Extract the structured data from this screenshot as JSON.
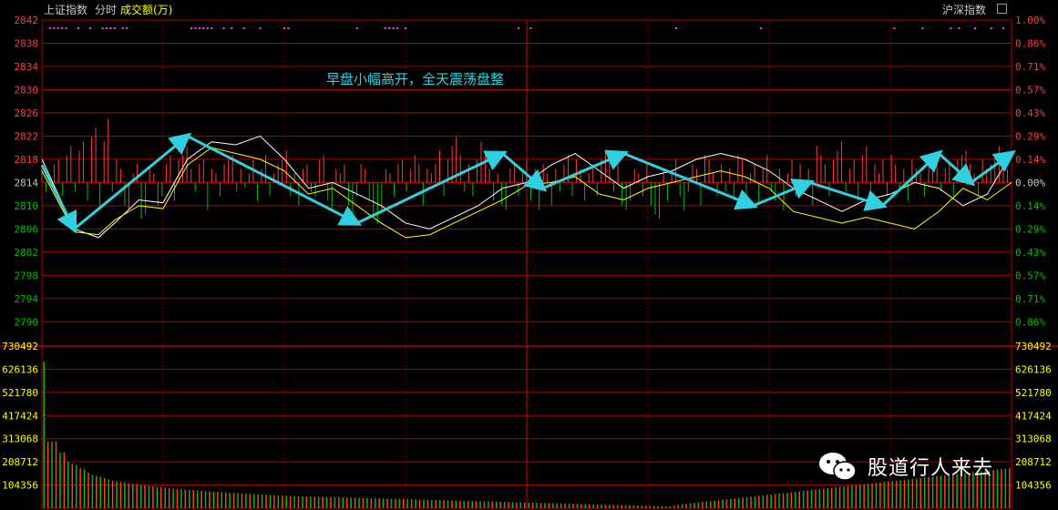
{
  "header": {
    "index_name": "上证指数",
    "mode_label": "分时",
    "volume_label": "成交额(万)",
    "market_label": "沪深指数"
  },
  "annotation": "早盘小幅高开，全天震荡盘整",
  "watermark": {
    "text": "股道行人来去",
    "icon": "wechat-icon"
  },
  "colors": {
    "up": "#ff3b3b",
    "down": "#00c000",
    "grid": "#b00000",
    "price_line": "#ffffff",
    "avg_line": "#ffff00",
    "arrow": "#30d0e0",
    "annotation": "#30d0e0",
    "volume_axis": "#ffff00",
    "marker": "#ff40ff"
  },
  "chart_data": [
    {
      "type": "line",
      "title": "",
      "y_ticks_left": [
        "2842",
        "2838",
        "2834",
        "2830",
        "2826",
        "2822",
        "2818",
        "2814",
        "2810",
        "2806",
        "2802",
        "2798",
        "2794",
        "2790"
      ],
      "y_ticks_right": [
        "1.00%",
        "0.86%",
        "0.71%",
        "0.57%",
        "0.43%",
        "0.29%",
        "0.14%",
        "0.00%",
        "0.14%",
        "0.29%",
        "0.43%",
        "0.57%",
        "0.71%",
        "0.86%"
      ],
      "ylim": [
        2788,
        2842
      ],
      "reference": 2814,
      "xlim": [
        0,
        240
      ],
      "series": [
        {
          "role": "price",
          "x": [
            0,
            8,
            14,
            18,
            24,
            30,
            36,
            42,
            48,
            54,
            60,
            66,
            72,
            78,
            84,
            90,
            96,
            102,
            108,
            114,
            120,
            126,
            132,
            138,
            144,
            150,
            156,
            162,
            168,
            174,
            180,
            186,
            192,
            198,
            204,
            210,
            216,
            222,
            228,
            234,
            240
          ],
          "values": [
            2818,
            2806,
            2804.5,
            2807,
            2811,
            2810.5,
            2818,
            2821,
            2820.5,
            2822,
            2818,
            2813,
            2814,
            2812,
            2810,
            2807,
            2806,
            2808,
            2810,
            2813,
            2814,
            2817,
            2819,
            2816,
            2813,
            2815,
            2816,
            2818,
            2819,
            2818,
            2816,
            2813,
            2811,
            2809,
            2811,
            2812,
            2814,
            2813,
            2810,
            2812,
            2819
          ]
        },
        {
          "role": "average",
          "x": [
            0,
            8,
            14,
            18,
            24,
            30,
            36,
            42,
            48,
            54,
            60,
            66,
            72,
            78,
            84,
            90,
            96,
            102,
            108,
            114,
            120,
            126,
            132,
            138,
            144,
            150,
            156,
            162,
            168,
            174,
            180,
            186,
            192,
            198,
            204,
            210,
            216,
            222,
            228,
            234,
            240
          ],
          "values": [
            2816,
            2805.5,
            2805,
            2807.5,
            2810,
            2809.5,
            2817,
            2820,
            2819,
            2818,
            2816,
            2812,
            2813,
            2810,
            2807,
            2804.5,
            2805,
            2807,
            2809,
            2811,
            2813.5,
            2814,
            2815,
            2812,
            2811,
            2813,
            2814,
            2815,
            2816,
            2815,
            2813,
            2809,
            2808,
            2807,
            2808,
            2807,
            2806,
            2809,
            2813,
            2811,
            2814
          ]
        }
      ],
      "trend_arrows": [
        {
          "from": [
            0,
            2817
          ],
          "to": [
            8,
            2806
          ]
        },
        {
          "from": [
            8,
            2806
          ],
          "to": [
            36,
            2822
          ]
        },
        {
          "from": [
            36,
            2822
          ],
          "to": [
            78,
            2807
          ]
        },
        {
          "from": [
            78,
            2807
          ],
          "to": [
            114,
            2819
          ]
        },
        {
          "from": [
            114,
            2819
          ],
          "to": [
            124,
            2813
          ]
        },
        {
          "from": [
            124,
            2813
          ],
          "to": [
            144,
            2819
          ]
        },
        {
          "from": [
            144,
            2819
          ],
          "to": [
            176,
            2810
          ]
        },
        {
          "from": [
            176,
            2810
          ],
          "to": [
            190,
            2814
          ]
        },
        {
          "from": [
            190,
            2814
          ],
          "to": [
            208,
            2810
          ]
        },
        {
          "from": [
            208,
            2810
          ],
          "to": [
            222,
            2819
          ]
        },
        {
          "from": [
            222,
            2819
          ],
          "to": [
            230,
            2814
          ]
        },
        {
          "from": [
            230,
            2814
          ],
          "to": [
            240,
            2819
          ]
        }
      ],
      "buy_sell_bars": [
        3,
        -2,
        -1,
        4,
        5,
        -3,
        6,
        8,
        -2,
        7,
        9,
        -4,
        10,
        12,
        -6,
        9,
        14,
        -2,
        5,
        3,
        -5,
        -6,
        2,
        4,
        -8,
        -7,
        3,
        2,
        -5,
        -3,
        4,
        6,
        -4,
        5,
        6,
        8,
        3,
        -2,
        4,
        5,
        -6,
        3,
        2,
        -3,
        4,
        5,
        6,
        -2,
        3,
        -1,
        2,
        5,
        -4,
        3,
        6,
        -3,
        2,
        4,
        5,
        7,
        -3,
        2,
        -5,
        3,
        4,
        -2,
        -3,
        5,
        6,
        -4,
        -6,
        3,
        2,
        4,
        -5,
        -8,
        -3,
        4,
        3,
        -4,
        -7,
        -9,
        -6,
        3,
        2,
        -3,
        4,
        5,
        -2,
        3,
        6,
        4,
        -5,
        3,
        2,
        4,
        7,
        -3,
        5,
        8,
        10,
        6,
        -2,
        4,
        -3,
        5,
        9,
        7,
        3,
        -4,
        2,
        -5,
        -6,
        3,
        4,
        -3,
        2,
        5,
        -4,
        3,
        -6,
        4,
        2,
        -5,
        3,
        -2,
        4,
        6,
        -3,
        5,
        3,
        -4,
        2,
        4,
        -3,
        5,
        7,
        6,
        -2,
        4,
        -5,
        -6,
        -4,
        3,
        2,
        -3,
        4,
        -5,
        -7,
        -8,
        3,
        -4,
        2,
        5,
        -3,
        -6,
        -2,
        4,
        3,
        -5,
        6,
        5,
        2,
        -3,
        4,
        -2,
        3,
        -4,
        6,
        5,
        -3,
        2,
        4,
        -5,
        3,
        6,
        -2,
        -4,
        3,
        -6,
        2,
        5,
        -3,
        4,
        -2,
        3,
        -5,
        8,
        6,
        4,
        -3,
        5,
        7,
        9,
        -2,
        3,
        5,
        -4,
        6,
        8,
        -3,
        4,
        2,
        5,
        -3,
        6,
        4,
        -2,
        3,
        -4,
        5,
        3,
        2,
        -3,
        4,
        6,
        5,
        -2,
        3,
        4,
        -3,
        5,
        6,
        7,
        4,
        2,
        -3,
        5,
        3,
        4,
        6,
        8,
        5,
        3
      ],
      "markers_minutes": [
        2,
        3,
        4,
        5,
        6,
        9,
        12,
        15,
        16,
        17,
        18,
        20,
        21,
        37,
        38,
        39,
        40,
        41,
        42,
        45,
        47,
        50,
        54,
        60,
        61,
        78,
        85,
        86,
        87,
        88,
        90,
        118,
        121,
        157,
        178,
        211,
        218,
        225,
        227,
        231,
        235,
        238
      ]
    },
    {
      "type": "bar",
      "title": "",
      "y_ticks": [
        "730492",
        "626136",
        "521780",
        "417424",
        "313068",
        "208712",
        "104356"
      ],
      "ylim": [
        0,
        730492
      ],
      "x_span": 241,
      "values": [
        660000,
        300000,
        300000,
        300000,
        250000,
        250000,
        210000,
        200000,
        195000,
        180000,
        175000,
        160000,
        150000,
        145000,
        140000,
        135000,
        130000,
        125000,
        120000,
        118000,
        115000,
        112000,
        110000,
        108000,
        105000,
        102000,
        100000,
        98000,
        96000,
        95000,
        93000,
        90000,
        88000,
        86000,
        85000,
        84000,
        83000,
        82000,
        80000,
        78000,
        77000,
        76000,
        75000,
        74000,
        73000,
        72000,
        70000,
        69000,
        68000,
        67000,
        66000,
        65000,
        64000,
        63000,
        62000,
        61000,
        60000,
        59000,
        58000,
        57000,
        56000,
        55000,
        54500,
        54000,
        53500,
        53000,
        52500,
        52000,
        51500,
        51000,
        50500,
        50000,
        49500,
        49000,
        48500,
        48000,
        47500,
        47000,
        46500,
        46000,
        45500,
        45000,
        44500,
        44000,
        43500,
        43000,
        42500,
        42000,
        41500,
        41000,
        40500,
        40000,
        39500,
        39000,
        38500,
        38000,
        37500,
        37000,
        36500,
        36000,
        35500,
        35000,
        34500,
        34000,
        33500,
        33000,
        32500,
        32000,
        31500,
        31000,
        30500,
        30000,
        29500,
        29000,
        28500,
        28000,
        27500,
        27000,
        26500,
        26000,
        25500,
        25000,
        24500,
        24000,
        23500,
        23000,
        22500,
        22000,
        21500,
        21000,
        20500,
        20000,
        19500,
        19000,
        18500,
        18000,
        17500,
        17000,
        16500,
        16000,
        15500,
        15000,
        14500,
        14000,
        13500,
        13000,
        12500,
        12000,
        11500,
        11000,
        10500,
        10000,
        9500,
        9000,
        8500,
        8000,
        12000,
        15000,
        18000,
        20000,
        22000,
        24000,
        26000,
        28000,
        30000,
        32000,
        34000,
        36000,
        38000,
        40000,
        42000,
        44000,
        46000,
        48000,
        50000,
        52000,
        54000,
        56000,
        58000,
        60000,
        62000,
        64000,
        66000,
        68000,
        70000,
        72000,
        74000,
        76000,
        78000,
        80000,
        82000,
        84000,
        86000,
        88000,
        90000,
        92000,
        94000,
        96000,
        98000,
        100000,
        102000,
        104000,
        106000,
        108000,
        110000,
        112000,
        114000,
        116000,
        118000,
        120000,
        122000,
        124000,
        126000,
        128000,
        130000,
        132000,
        134000,
        136000,
        138000,
        140000,
        142000,
        144000,
        146000,
        148000,
        150000,
        152000,
        154000,
        156000,
        158000,
        160000,
        162000,
        164000,
        166000,
        168000,
        170000,
        172000,
        174000,
        176000,
        178000,
        180000
      ],
      "colors_by_minute": "alternating"
    }
  ]
}
